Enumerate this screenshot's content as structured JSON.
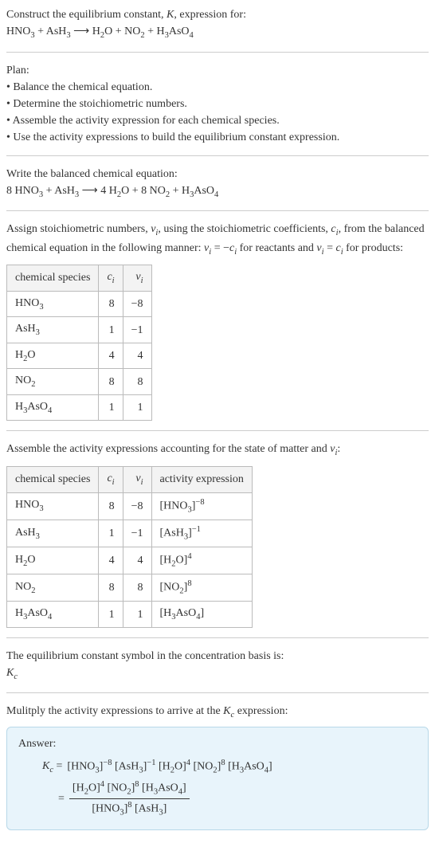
{
  "header": {
    "line1": "Construct the equilibrium constant, K, expression for:",
    "equation": "HNO₃ + AsH₃ ⟶ H₂O + NO₂ + H₃AsO₄"
  },
  "plan": {
    "title": "Plan:",
    "items": [
      "• Balance the chemical equation.",
      "• Determine the stoichiometric numbers.",
      "• Assemble the activity expression for each chemical species.",
      "• Use the activity expressions to build the equilibrium constant expression."
    ]
  },
  "balanced": {
    "title": "Write the balanced chemical equation:",
    "equation": "8 HNO₃ + AsH₃ ⟶ 4 H₂O + 8 NO₂ + H₃AsO₄"
  },
  "stoich": {
    "intro_a": "Assign stoichiometric numbers, νᵢ, using the stoichiometric coefficients, cᵢ, from the balanced chemical equation in the following manner: νᵢ = −cᵢ for reactants and νᵢ = cᵢ for products:",
    "headers": [
      "chemical species",
      "cᵢ",
      "νᵢ"
    ],
    "rows": [
      {
        "species": "HNO₃",
        "c": "8",
        "v": "−8"
      },
      {
        "species": "AsH₃",
        "c": "1",
        "v": "−1"
      },
      {
        "species": "H₂O",
        "c": "4",
        "v": "4"
      },
      {
        "species": "NO₂",
        "c": "8",
        "v": "8"
      },
      {
        "species": "H₃AsO₄",
        "c": "1",
        "v": "1"
      }
    ]
  },
  "activity": {
    "intro": "Assemble the activity expressions accounting for the state of matter and νᵢ:",
    "headers": [
      "chemical species",
      "cᵢ",
      "νᵢ",
      "activity expression"
    ],
    "rows": [
      {
        "species": "HNO₃",
        "c": "8",
        "v": "−8",
        "expr": "[HNO₃]⁻⁸"
      },
      {
        "species": "AsH₃",
        "c": "1",
        "v": "−1",
        "expr": "[AsH₃]⁻¹"
      },
      {
        "species": "H₂O",
        "c": "4",
        "v": "4",
        "expr": "[H₂O]⁴"
      },
      {
        "species": "NO₂",
        "c": "8",
        "v": "8",
        "expr": "[NO₂]⁸"
      },
      {
        "species": "H₃AsO₄",
        "c": "1",
        "v": "1",
        "expr": "[H₃AsO₄]"
      }
    ]
  },
  "symbol": {
    "line1": "The equilibrium constant symbol in the concentration basis is:",
    "line2": "K_c"
  },
  "multiply": {
    "title": "Mulitply the activity expressions to arrive at the K_c expression:"
  },
  "answer": {
    "label": "Answer:",
    "lhs": "K_c =",
    "flat": "[HNO₃]⁻⁸ [AsH₃]⁻¹ [H₂O]⁴ [NO₂]⁸ [H₃AsO₄]",
    "eq": "=",
    "numerator": "[H₂O]⁴ [NO₂]⁸ [H₃AsO₄]",
    "denominator": "[HNO₃]⁸ [AsH₃]"
  },
  "chart_data": {
    "type": "table",
    "tables": [
      {
        "title": "Stoichiometric numbers",
        "columns": [
          "chemical species",
          "c_i",
          "ν_i"
        ],
        "rows": [
          [
            "HNO3",
            8,
            -8
          ],
          [
            "AsH3",
            1,
            -1
          ],
          [
            "H2O",
            4,
            4
          ],
          [
            "NO2",
            8,
            8
          ],
          [
            "H3AsO4",
            1,
            1
          ]
        ]
      },
      {
        "title": "Activity expressions",
        "columns": [
          "chemical species",
          "c_i",
          "ν_i",
          "activity expression"
        ],
        "rows": [
          [
            "HNO3",
            8,
            -8,
            "[HNO3]^-8"
          ],
          [
            "AsH3",
            1,
            -1,
            "[AsH3]^-1"
          ],
          [
            "H2O",
            4,
            4,
            "[H2O]^4"
          ],
          [
            "NO2",
            8,
            8,
            "[NO2]^8"
          ],
          [
            "H3AsO4",
            1,
            1,
            "[H3AsO4]"
          ]
        ]
      }
    ]
  }
}
